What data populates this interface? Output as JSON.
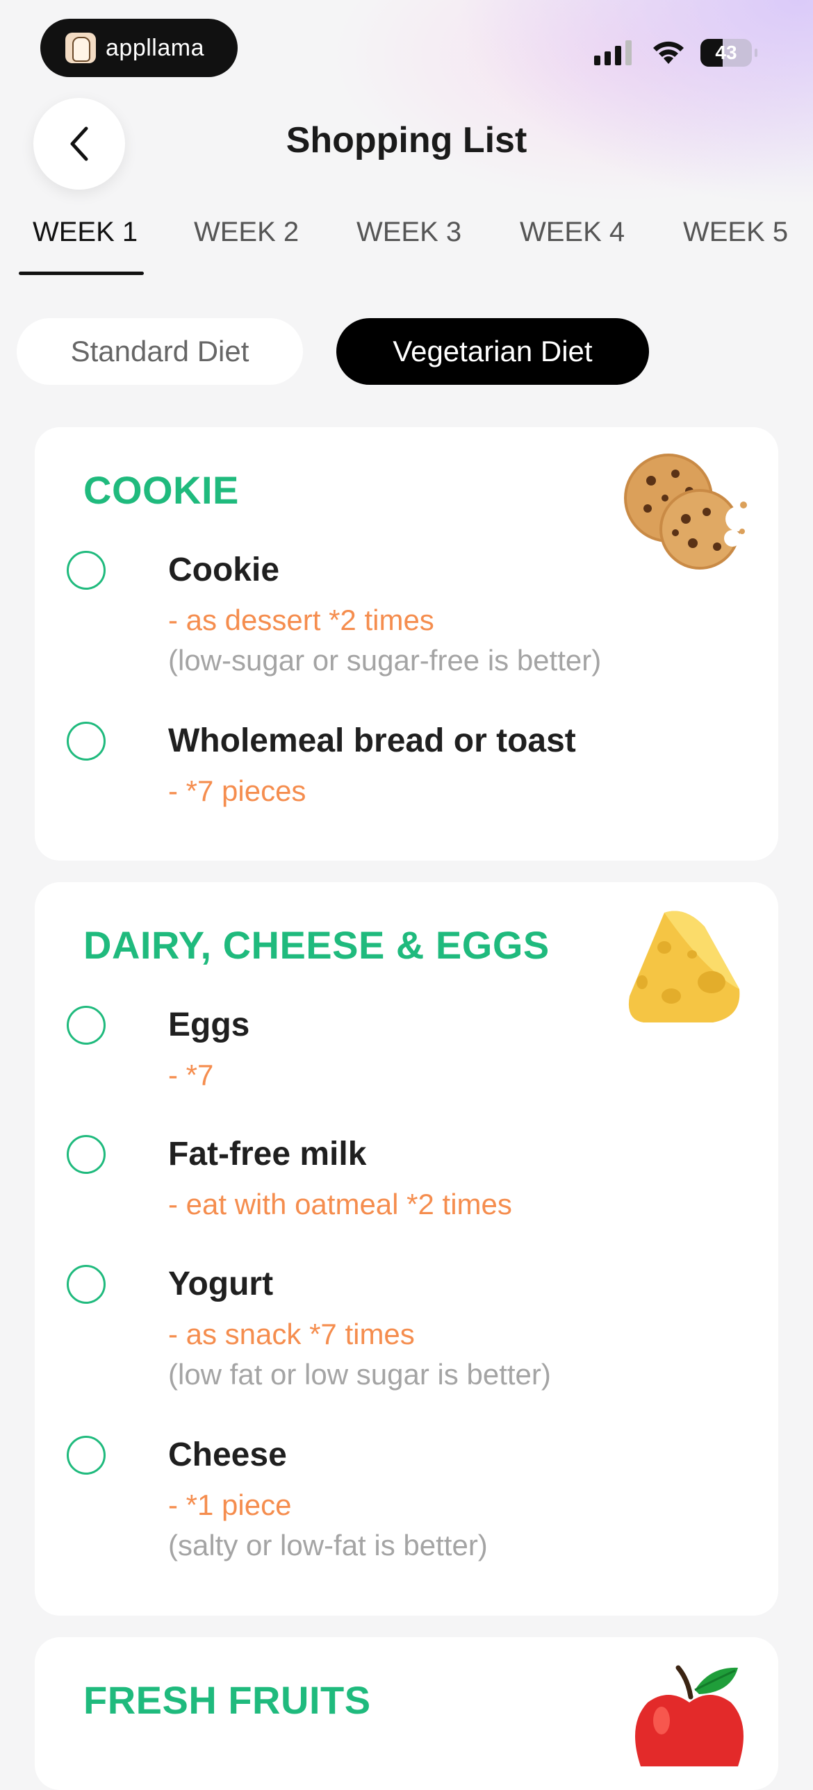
{
  "status_bar": {
    "app_name": "appllama",
    "battery_percent": "43"
  },
  "header": {
    "title": "Shopping List"
  },
  "tabs": [
    {
      "label": "WEEK 1",
      "active": true
    },
    {
      "label": "WEEK 2",
      "active": false
    },
    {
      "label": "WEEK 3",
      "active": false
    },
    {
      "label": "WEEK 4",
      "active": false
    },
    {
      "label": "WEEK 5",
      "active": false
    }
  ],
  "diet_toggle": {
    "standard_label": "Standard Diet",
    "vegetarian_label": "Vegetarian Diet",
    "selected": "Vegetarian Diet"
  },
  "categories": [
    {
      "title": "COOKIE",
      "icon": "cookie-icon",
      "items": [
        {
          "name": "Cookie",
          "qty": "- as dessert *2 times",
          "note": "(low-sugar or sugar-free is better)"
        },
        {
          "name": "Wholemeal bread or toast",
          "qty": "- *7 pieces",
          "note": ""
        }
      ]
    },
    {
      "title": "DAIRY, CHEESE & EGGS",
      "icon": "cheese-icon",
      "items": [
        {
          "name": "Eggs",
          "qty": "- *7",
          "note": ""
        },
        {
          "name": "Fat-free milk",
          "qty": "- eat with oatmeal *2 times",
          "note": ""
        },
        {
          "name": "Yogurt",
          "qty": "- as snack *7 times",
          "note": "(low fat or low sugar is better)"
        },
        {
          "name": "Cheese",
          "qty": "- *1 piece",
          "note": "(salty or low-fat is better)"
        }
      ]
    },
    {
      "title": "FRESH FRUITS",
      "icon": "apple-icon",
      "items": []
    }
  ],
  "colors": {
    "accent_green": "#1fba7d",
    "quantity_orange": "#f58d4e",
    "note_gray": "#a4a4a4"
  }
}
